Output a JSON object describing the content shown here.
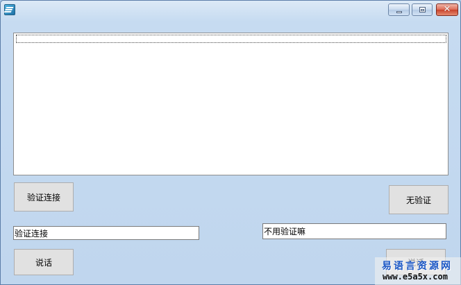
{
  "window": {
    "title": "",
    "controls": {
      "minimize": "▭",
      "maximize": "▣",
      "close": "✕"
    }
  },
  "log_list": {
    "items": []
  },
  "buttons": {
    "verify_connect": "验证连接",
    "no_verify": "无验证",
    "say_left": "说话",
    "say_right": "说话"
  },
  "inputs": {
    "left_value": "验证连接",
    "right_value": "不用验证嘛"
  },
  "watermark": {
    "cn": "易语言资源网",
    "url": "www.e5a5x.com"
  }
}
